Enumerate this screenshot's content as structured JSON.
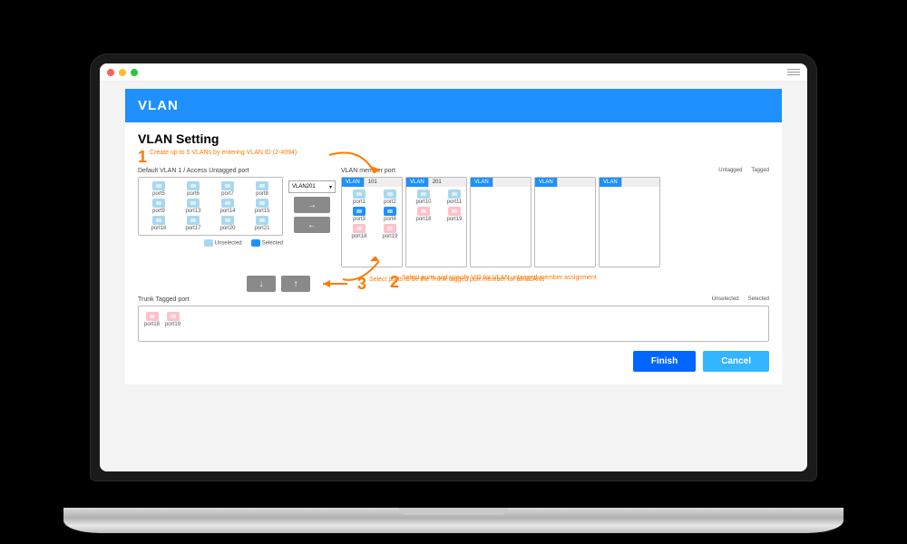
{
  "banner": {
    "title": "VLAN"
  },
  "heading": "VLAN Setting",
  "steps": {
    "s1": "Create up to 5 VLANs by entering VLAN ID (2-4094)",
    "s2": "Select ports and specify VID for VLAN untagged member assignment",
    "s3": "Select ports to be the Trunk tagged port member for all VLANs"
  },
  "labels": {
    "default_col": "Default VLAN 1 / Access Untagged port",
    "member_col": "VLAN member port",
    "trunk_col": "Trunk Tagged port"
  },
  "legend": {
    "unselected": "Unselected",
    "selected": "Selected",
    "untagged": "Untagged",
    "tagged": "Tagged"
  },
  "dropdown": {
    "selected": "VLAN201"
  },
  "default_ports": [
    "port5",
    "port6",
    "port7",
    "port8",
    "port9",
    "port13",
    "port14",
    "port15",
    "port16",
    "port17",
    "port20",
    "port21"
  ],
  "vlan_columns": [
    {
      "name": "VLAN",
      "id": "101",
      "ports": [
        {
          "label": "port1",
          "type": "blue-light"
        },
        {
          "label": "port2",
          "type": "blue-light"
        },
        {
          "label": "port3",
          "type": "blue"
        },
        {
          "label": "port4",
          "type": "blue"
        },
        {
          "label": "port18",
          "type": "pink-light"
        },
        {
          "label": "port19",
          "type": "pink-light"
        }
      ]
    },
    {
      "name": "VLAN",
      "id": "201",
      "ports": [
        {
          "label": "port10",
          "type": "blue-light"
        },
        {
          "label": "port11",
          "type": "blue-light"
        },
        {
          "label": "port18",
          "type": "pink-light"
        },
        {
          "label": "port19",
          "type": "pink-light"
        }
      ]
    },
    {
      "name": "VLAN",
      "id": "",
      "ports": []
    },
    {
      "name": "VLAN",
      "id": "",
      "ports": []
    },
    {
      "name": "VLAN",
      "id": "",
      "ports": []
    }
  ],
  "trunk_ports": [
    {
      "label": "port18",
      "type": "pink-light"
    },
    {
      "label": "port19",
      "type": "pink-light"
    }
  ],
  "buttons": {
    "finish": "Finish",
    "cancel": "Cancel"
  }
}
